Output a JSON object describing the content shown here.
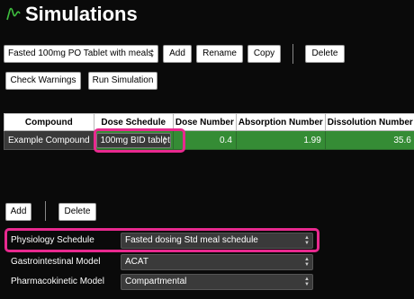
{
  "header": {
    "title": "Simulations",
    "icon": "simulation-curve-icon",
    "icon_color": "#3fbf3f"
  },
  "toolbar": {
    "simulation_select": "Fasted 100mg PO Tablet with meals",
    "add_label": "Add",
    "rename_label": "Rename",
    "copy_label": "Copy",
    "delete_label": "Delete",
    "check_warnings_label": "Check Warnings",
    "run_simulation_label": "Run Simulation"
  },
  "table": {
    "columns": [
      "Compound",
      "Dose Schedule",
      "Dose Number",
      "Absorption Number",
      "Dissolution Number"
    ],
    "rows": [
      {
        "compound": "Example Compound",
        "dose_schedule": "100mg BID tablet",
        "dose_number": "0.4",
        "absorption_number": "1.99",
        "dissolution_number": "35.6"
      }
    ]
  },
  "row_actions": {
    "add_label": "Add",
    "delete_label": "Delete"
  },
  "properties": [
    {
      "label": "Physiology Schedule",
      "value": "Fasted dosing Std meal schedule"
    },
    {
      "label": "Gastrointestinal Model",
      "value": "ACAT"
    },
    {
      "label": "Pharmacokinetic Model",
      "value": "Compartmental"
    }
  ],
  "colors": {
    "background": "#0a0a0a",
    "cell_green": "#358c35",
    "highlight": "#e8298f"
  }
}
